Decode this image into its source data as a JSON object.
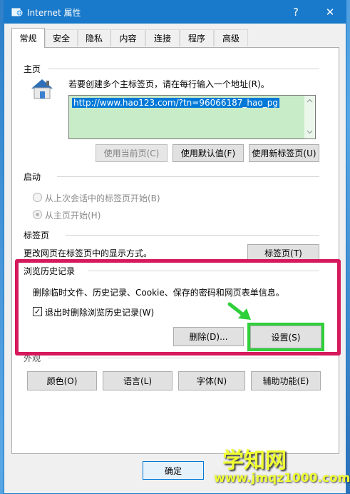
{
  "window": {
    "title": "Internet 属性",
    "help_glyph": "?",
    "close_glyph": "✕"
  },
  "tabs": [
    "常规",
    "安全",
    "隐私",
    "内容",
    "连接",
    "程序",
    "高级"
  ],
  "home": {
    "group_label": "主页",
    "instruction": "若要创建多个主标签页，请在每行输入一个地址(R)。",
    "url_value": "http://www.hao123.com/?tn=96066187_hao_pg",
    "buttons": {
      "use_current": "使用当前页(C)",
      "use_default": "使用默认值(F)",
      "use_new_tab": "使用新标签页(U)"
    }
  },
  "startup": {
    "group_label": "启动",
    "option_last_session": "从上次会话中的标签页开始(B)",
    "option_home": "从主页开始(H)"
  },
  "tabs_section": {
    "group_label": "标签页",
    "description": "更改网页在标签页中的显示方式。",
    "button": "标签页(T)"
  },
  "history": {
    "group_label": "浏览历史记录",
    "description": "删除临时文件、历史记录、Cookie、保存的密码和网页表单信息。",
    "checkbox_label": "退出时删除浏览历史记录(W)",
    "checkbox_checked": true,
    "delete_button": "删除(D)...",
    "settings_button": "设置(S)"
  },
  "appearance": {
    "group_label_partial": "外观",
    "buttons": {
      "colors": "颜色(O)",
      "languages": "语言(L)",
      "fonts": "字体(N)",
      "accessibility": "辅助功能(E)"
    }
  },
  "footer": {
    "ok_button": "确定"
  },
  "watermark": {
    "main": "学知网",
    "url": "www.jmqz1000.com"
  },
  "colors": {
    "title_bar": "#1979ca",
    "highlight_red": "#d5195c",
    "highlight_green": "#2fd03a",
    "url_bg": "#c8ecc8",
    "selection": "#0078d7",
    "watermark": "#f0ff33"
  }
}
